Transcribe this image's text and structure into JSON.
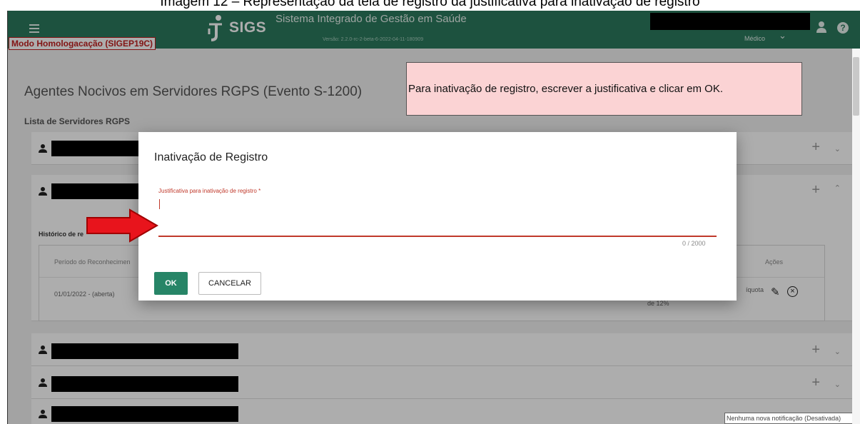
{
  "caption": "Imagem 12 – Representação da tela de registro da justificativa para inativação de registro",
  "topbar": {
    "logo_text": "SIGS",
    "system_title": "Sistema Integrado de Gestão em Saúde",
    "version": "Versão: 2.2.0-rc-2-beta-6-2022-04-11-180909",
    "role": "Médico",
    "help": "?"
  },
  "mode_badge": "Modo Homologacação (SIGEP19C)",
  "page": {
    "title": "Agentes Nocivos em Servidores RGPS (Evento S-1200)",
    "list_title": "Lista de Servidores RGPS"
  },
  "hint": "Para inativação de registro, escrever a justificativa e clicar em OK.",
  "panel": {
    "historico_label": "Histórico de re",
    "col_periodo": "Período do Reconhecimen",
    "col_acoes": "Ações",
    "row_periodo": "01/01/2022 - (aberta)",
    "row_aliquota_1": "íquota",
    "row_aliquota_2": "de 12%"
  },
  "dialog": {
    "title": "Inativação de Registro",
    "field_label": "Justificativa para inativação de registro *",
    "field_value": "",
    "counter": "0 / 2000",
    "ok_label": "OK",
    "cancel_label": "CANCELAR"
  },
  "notification": "Nenhuma nova notificação (Desativada)",
  "colors": {
    "topbar": "#2c7a5e",
    "ok_button": "#278567",
    "error_red": "#c0392b",
    "hint_bg": "#fbd3d4",
    "arrow": "#e8141c"
  }
}
